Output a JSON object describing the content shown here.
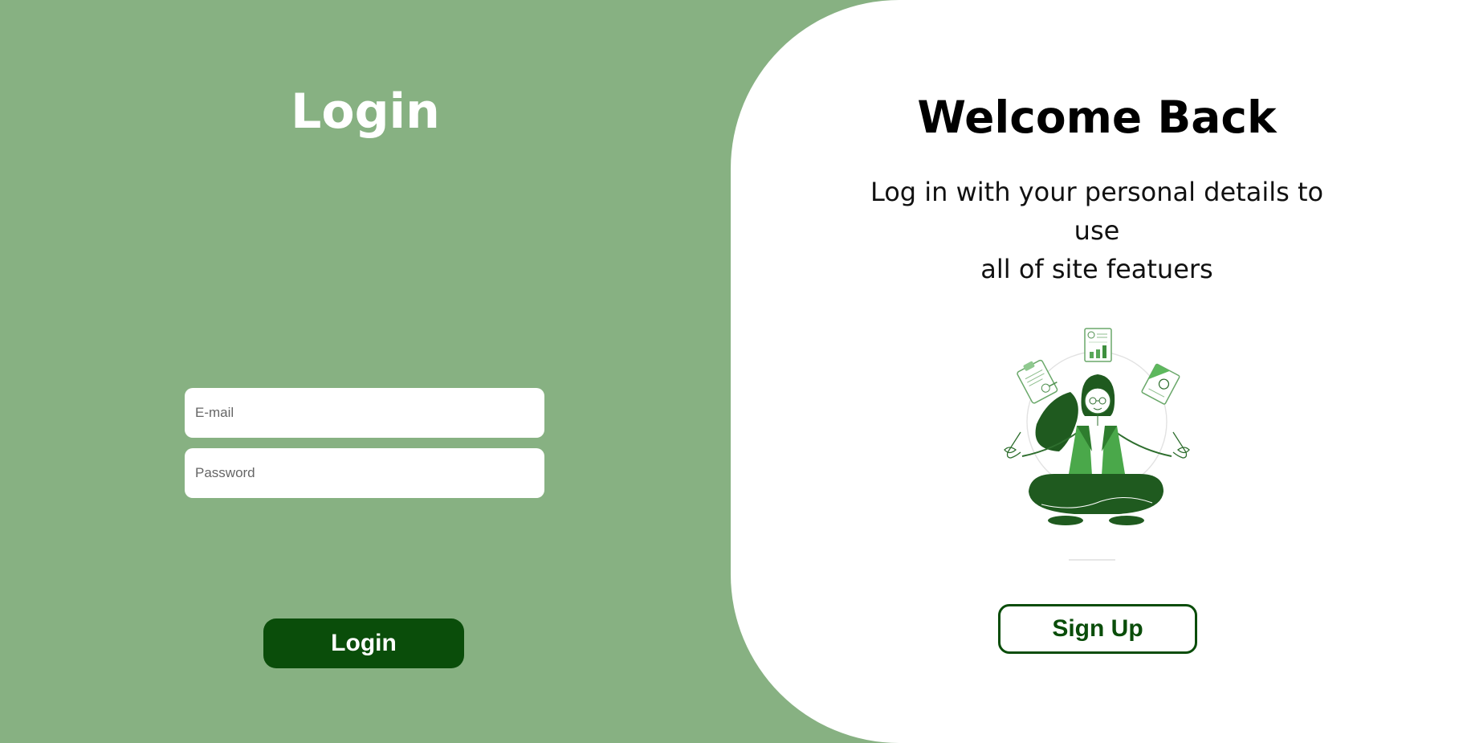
{
  "left_panel": {
    "title": "Login",
    "email_placeholder": "E-mail",
    "password_placeholder": "Password",
    "login_button": "Login"
  },
  "right_panel": {
    "title": "Welcome Back",
    "line1": "Log in with your personal details to use",
    "line2": "all of site featuers",
    "signup_button": "Sign Up"
  },
  "colors": {
    "background": "#87b182",
    "primary_dark": "#0a4d0a",
    "accent_green": "#4caf50",
    "white": "#ffffff"
  }
}
